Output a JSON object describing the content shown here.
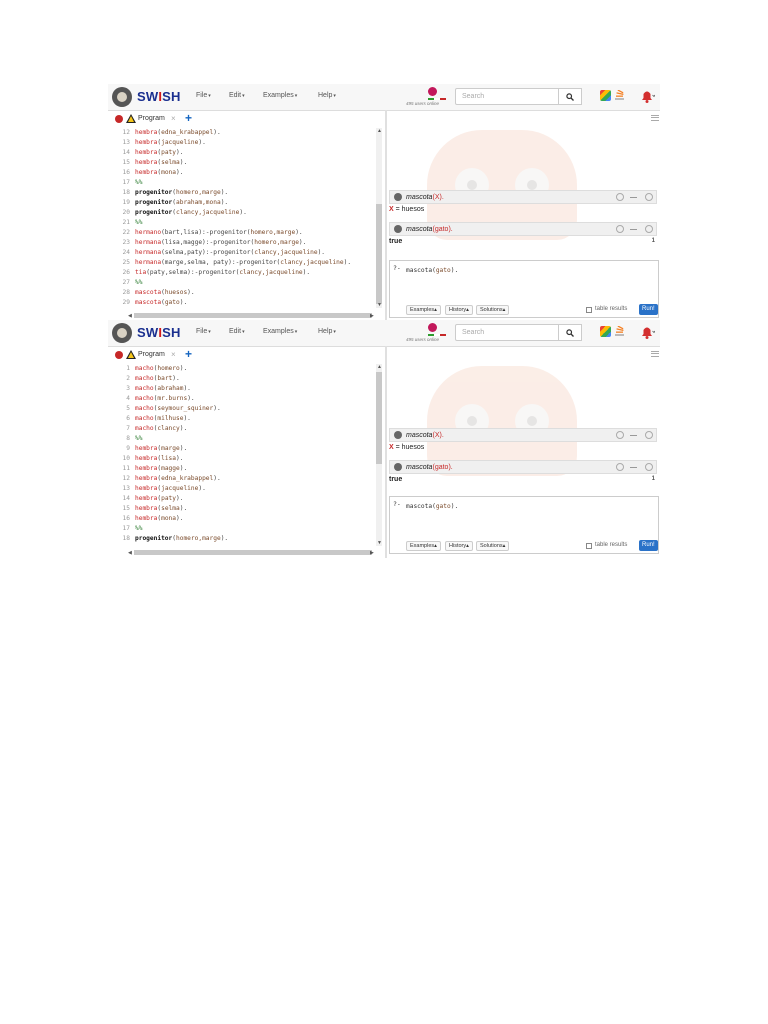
{
  "app": {
    "brand_prefix": "SW",
    "brand_accent": "I",
    "brand_suffix": "SH",
    "menus": [
      "File",
      "Edit",
      "Examples",
      "Help"
    ],
    "users_online": "495 users online",
    "search_placeholder": "Search",
    "tab_label": "Program",
    "tab_close": "×",
    "tab_add": "+"
  },
  "screens": [
    {
      "code": [
        {
          "n": "12",
          "parts": [
            {
              "t": "hembra",
              "c": "kw-red"
            },
            {
              "t": "(",
              "c": ""
            },
            {
              "t": "edna_krabappel",
              "c": "arg"
            },
            {
              "t": ").",
              "c": ""
            }
          ]
        },
        {
          "n": "13",
          "parts": [
            {
              "t": "hembra",
              "c": "kw-red"
            },
            {
              "t": "(",
              "c": ""
            },
            {
              "t": "jacqueline",
              "c": "arg"
            },
            {
              "t": ").",
              "c": ""
            }
          ]
        },
        {
          "n": "14",
          "parts": [
            {
              "t": "hembra",
              "c": "kw-red"
            },
            {
              "t": "(",
              "c": ""
            },
            {
              "t": "paty",
              "c": "arg"
            },
            {
              "t": ").",
              "c": ""
            }
          ]
        },
        {
          "n": "15",
          "parts": [
            {
              "t": "hembra",
              "c": "kw-red"
            },
            {
              "t": "(",
              "c": ""
            },
            {
              "t": "selma",
              "c": "arg"
            },
            {
              "t": ").",
              "c": ""
            }
          ]
        },
        {
          "n": "16",
          "parts": [
            {
              "t": "hembra",
              "c": "kw-red"
            },
            {
              "t": "(",
              "c": ""
            },
            {
              "t": "mona",
              "c": "arg"
            },
            {
              "t": ").",
              "c": ""
            }
          ]
        },
        {
          "n": "17",
          "parts": [
            {
              "t": "%%",
              "c": "kw-green"
            }
          ]
        },
        {
          "n": "18",
          "parts": [
            {
              "t": "progenitor",
              "c": "kw-bold"
            },
            {
              "t": "(",
              "c": ""
            },
            {
              "t": "homero,marge",
              "c": "arg"
            },
            {
              "t": ").",
              "c": ""
            }
          ]
        },
        {
          "n": "19",
          "parts": [
            {
              "t": "progenitor",
              "c": "kw-bold"
            },
            {
              "t": "(",
              "c": ""
            },
            {
              "t": "abraham,mona",
              "c": "arg"
            },
            {
              "t": ").",
              "c": ""
            }
          ]
        },
        {
          "n": "20",
          "parts": [
            {
              "t": "progenitor",
              "c": "kw-bold"
            },
            {
              "t": "(",
              "c": ""
            },
            {
              "t": "clancy,jacqueline",
              "c": "arg"
            },
            {
              "t": ").",
              "c": ""
            }
          ]
        },
        {
          "n": "21",
          "parts": [
            {
              "t": "%%",
              "c": "kw-green"
            }
          ]
        },
        {
          "n": "22",
          "parts": [
            {
              "t": "hermano",
              "c": "kw-red"
            },
            {
              "t": "(bart,lisa):-progenitor(",
              "c": ""
            },
            {
              "t": "homero,marge",
              "c": "arg"
            },
            {
              "t": ").",
              "c": ""
            }
          ]
        },
        {
          "n": "23",
          "parts": [
            {
              "t": "hermana",
              "c": "kw-red"
            },
            {
              "t": "(lisa,magge):-progenitor(",
              "c": ""
            },
            {
              "t": "homero,marge",
              "c": "arg"
            },
            {
              "t": ").",
              "c": ""
            }
          ]
        },
        {
          "n": "24",
          "parts": [
            {
              "t": "hermana",
              "c": "kw-red"
            },
            {
              "t": "(selma,paty):-progenitor(",
              "c": ""
            },
            {
              "t": "clancy,jacqueline",
              "c": "arg"
            },
            {
              "t": ").",
              "c": ""
            }
          ]
        },
        {
          "n": "25",
          "parts": [
            {
              "t": "hermana",
              "c": "kw-red"
            },
            {
              "t": "(marge,selma, paty):-progenitor(",
              "c": ""
            },
            {
              "t": "clancy,jacqueline",
              "c": "arg"
            },
            {
              "t": ").",
              "c": ""
            }
          ]
        },
        {
          "n": "26",
          "parts": [
            {
              "t": "tia",
              "c": "kw-red"
            },
            {
              "t": "(paty,selma):-progenitor(",
              "c": ""
            },
            {
              "t": "clancy,jacqueline",
              "c": "arg"
            },
            {
              "t": ").",
              "c": ""
            }
          ]
        },
        {
          "n": "27",
          "parts": [
            {
              "t": "%%",
              "c": "kw-green"
            }
          ]
        },
        {
          "n": "28",
          "parts": [
            {
              "t": "mascota",
              "c": "kw-red"
            },
            {
              "t": "(",
              "c": ""
            },
            {
              "t": "huesos",
              "c": "arg"
            },
            {
              "t": ").",
              "c": ""
            }
          ]
        },
        {
          "n": "29",
          "parts": [
            {
              "t": "mascota",
              "c": "kw-red"
            },
            {
              "t": "(",
              "c": ""
            },
            {
              "t": "gato",
              "c": "arg"
            },
            {
              "t": ").",
              "c": ""
            }
          ]
        }
      ]
    },
    {
      "code": [
        {
          "n": "1",
          "parts": [
            {
              "t": "macho",
              "c": "kw-red"
            },
            {
              "t": "(",
              "c": ""
            },
            {
              "t": "homero",
              "c": "arg"
            },
            {
              "t": ").",
              "c": ""
            }
          ]
        },
        {
          "n": "2",
          "parts": [
            {
              "t": "macho",
              "c": "kw-red"
            },
            {
              "t": "(",
              "c": ""
            },
            {
              "t": "bart",
              "c": "arg"
            },
            {
              "t": ").",
              "c": ""
            }
          ]
        },
        {
          "n": "3",
          "parts": [
            {
              "t": "macho",
              "c": "kw-red"
            },
            {
              "t": "(",
              "c": ""
            },
            {
              "t": "abraham",
              "c": "arg"
            },
            {
              "t": ").",
              "c": ""
            }
          ]
        },
        {
          "n": "4",
          "parts": [
            {
              "t": "macho",
              "c": "kw-red"
            },
            {
              "t": "(",
              "c": ""
            },
            {
              "t": "mr.burns",
              "c": "arg"
            },
            {
              "t": ").",
              "c": ""
            }
          ]
        },
        {
          "n": "5",
          "parts": [
            {
              "t": "macho",
              "c": "kw-red"
            },
            {
              "t": "(",
              "c": ""
            },
            {
              "t": "seymour_squiner",
              "c": "arg"
            },
            {
              "t": ").",
              "c": ""
            }
          ]
        },
        {
          "n": "6",
          "parts": [
            {
              "t": "macho",
              "c": "kw-red"
            },
            {
              "t": "(",
              "c": ""
            },
            {
              "t": "milhuse",
              "c": "arg"
            },
            {
              "t": ").",
              "c": ""
            }
          ]
        },
        {
          "n": "7",
          "parts": [
            {
              "t": "macho",
              "c": "kw-red"
            },
            {
              "t": "(",
              "c": ""
            },
            {
              "t": "clancy",
              "c": "arg"
            },
            {
              "t": ").",
              "c": ""
            }
          ]
        },
        {
          "n": "8",
          "parts": [
            {
              "t": "%%",
              "c": "kw-green"
            }
          ]
        },
        {
          "n": "9",
          "parts": [
            {
              "t": "hembra",
              "c": "kw-red"
            },
            {
              "t": "(",
              "c": ""
            },
            {
              "t": "marge",
              "c": "arg"
            },
            {
              "t": ").",
              "c": ""
            }
          ]
        },
        {
          "n": "10",
          "parts": [
            {
              "t": "hembra",
              "c": "kw-red"
            },
            {
              "t": "(",
              "c": ""
            },
            {
              "t": "lisa",
              "c": "arg"
            },
            {
              "t": ").",
              "c": ""
            }
          ]
        },
        {
          "n": "11",
          "parts": [
            {
              "t": "hembra",
              "c": "kw-red"
            },
            {
              "t": "(",
              "c": ""
            },
            {
              "t": "magge",
              "c": "arg"
            },
            {
              "t": ").",
              "c": ""
            }
          ]
        },
        {
          "n": "12",
          "parts": [
            {
              "t": "hembra",
              "c": "kw-red"
            },
            {
              "t": "(",
              "c": ""
            },
            {
              "t": "edna_krabappel",
              "c": "arg"
            },
            {
              "t": ").",
              "c": ""
            }
          ]
        },
        {
          "n": "13",
          "parts": [
            {
              "t": "hembra",
              "c": "kw-red"
            },
            {
              "t": "(",
              "c": ""
            },
            {
              "t": "jacqueline",
              "c": "arg"
            },
            {
              "t": ").",
              "c": ""
            }
          ]
        },
        {
          "n": "14",
          "parts": [
            {
              "t": "hembra",
              "c": "kw-red"
            },
            {
              "t": "(",
              "c": ""
            },
            {
              "t": "paty",
              "c": "arg"
            },
            {
              "t": ").",
              "c": ""
            }
          ]
        },
        {
          "n": "15",
          "parts": [
            {
              "t": "hembra",
              "c": "kw-red"
            },
            {
              "t": "(",
              "c": ""
            },
            {
              "t": "selma",
              "c": "arg"
            },
            {
              "t": ").",
              "c": ""
            }
          ]
        },
        {
          "n": "16",
          "parts": [
            {
              "t": "hembra",
              "c": "kw-red"
            },
            {
              "t": "(",
              "c": ""
            },
            {
              "t": "mona",
              "c": "arg"
            },
            {
              "t": ").",
              "c": ""
            }
          ]
        },
        {
          "n": "17",
          "parts": [
            {
              "t": "%%",
              "c": "kw-green"
            }
          ]
        },
        {
          "n": "18",
          "parts": [
            {
              "t": "progenitor",
              "c": "kw-bold"
            },
            {
              "t": "(",
              "c": ""
            },
            {
              "t": "homero,marge",
              "c": "arg"
            },
            {
              "t": ").",
              "c": ""
            }
          ]
        }
      ]
    }
  ],
  "results": {
    "query1_pred": "mascota",
    "query1_arg": "X",
    "answer_var": "X",
    "answer_eq": " = huesos",
    "query2_pred": "mascota",
    "query2_arg": "gato",
    "answer2": "true",
    "answer2_count": "1"
  },
  "query": {
    "prompt": "?-",
    "pred": "mascota(",
    "arg": "gato",
    "end": ").",
    "buttons": [
      "Examples",
      "History",
      "Solutions"
    ],
    "table_results": "table results",
    "run": "Run!"
  }
}
